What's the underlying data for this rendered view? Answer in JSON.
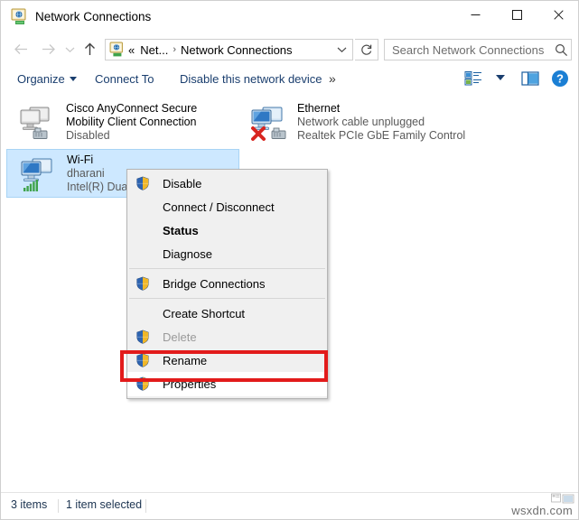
{
  "window": {
    "title": "Network Connections",
    "icon": "network-connections-icon",
    "controls": {
      "minimize": "minimize-icon",
      "maximize": "maximize-icon",
      "close": "close-icon"
    }
  },
  "nav": {
    "back": "back-arrow-icon",
    "forward": "forward-arrow-icon",
    "recent": "recent-locations-chevron-icon",
    "up": "up-arrow-icon",
    "address": {
      "icon": "network-connections-icon",
      "crumbs": [
        "«",
        "Net...",
        "Network Connections"
      ],
      "separator": "›",
      "dropdown": "chevron-down-icon"
    },
    "refresh": "refresh-icon"
  },
  "search": {
    "placeholder": "Search Network Connections",
    "icon": "search-icon"
  },
  "toolbar": {
    "organize": "Organize",
    "connect_to": "Connect To",
    "disable_device": "Disable this network device",
    "overflow": "»",
    "view_icon": "change-view-icon",
    "preview_icon": "preview-pane-icon",
    "help_icon": "help-icon"
  },
  "connections": [
    {
      "name": "Cisco AnyConnect Secure Mobility Client Connection",
      "status": "Disabled",
      "device": "",
      "icon": "network-adapter-disabled-icon",
      "selected": false
    },
    {
      "name": "Ethernet",
      "status": "Network cable unplugged",
      "device": "Realtek PCIe GbE Family Controller",
      "icon": "network-adapter-unplugged-icon",
      "selected": false
    },
    {
      "name": "Wi-Fi",
      "status": "dharani",
      "device": "Intel(R) Dual Band Wireless-AC",
      "icon": "wifi-adapter-icon",
      "selected": true
    }
  ],
  "context_menu": {
    "items": [
      {
        "label": "Disable",
        "shield": true,
        "bold": false,
        "disabled": false,
        "separator_after": false
      },
      {
        "label": "Connect / Disconnect",
        "shield": false,
        "bold": false,
        "disabled": false,
        "separator_after": false
      },
      {
        "label": "Status",
        "shield": false,
        "bold": true,
        "disabled": false,
        "separator_after": false
      },
      {
        "label": "Diagnose",
        "shield": false,
        "bold": false,
        "disabled": false,
        "separator_after": true
      },
      {
        "label": "Bridge Connections",
        "shield": true,
        "bold": false,
        "disabled": false,
        "separator_after": true
      },
      {
        "label": "Create Shortcut",
        "shield": false,
        "bold": false,
        "disabled": false,
        "separator_after": false
      },
      {
        "label": "Delete",
        "shield": true,
        "bold": false,
        "disabled": true,
        "separator_after": false
      },
      {
        "label": "Rename",
        "shield": true,
        "bold": false,
        "disabled": false,
        "separator_after": false
      },
      {
        "label": "Properties",
        "shield": true,
        "bold": false,
        "disabled": false,
        "separator_after": false,
        "highlighted": true
      }
    ],
    "highlight_color": "#e21b1b"
  },
  "status_bar": {
    "item_count": "3 items",
    "selection": "1 item selected"
  },
  "watermark": {
    "text": "wsxdn.com"
  },
  "colors": {
    "selection_blue": "#cde8ff",
    "link_blue": "#1a3e6e",
    "annotation_red": "#e21b1b",
    "menu_gray": "#f0f0f0"
  }
}
